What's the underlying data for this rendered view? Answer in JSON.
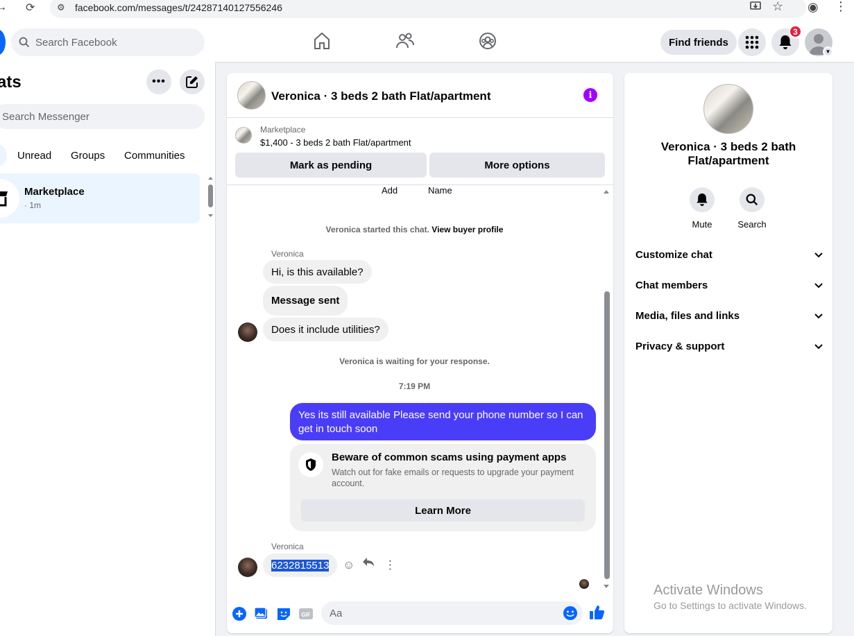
{
  "browser": {
    "url": "facebook.com/messages/t/24287140127556246"
  },
  "header": {
    "search_placeholder": "Search Facebook",
    "find_friends": "Find friends",
    "notifications_count": "3"
  },
  "sidebar": {
    "title": "ats",
    "search_placeholder": "Search Messenger",
    "filters": [
      "Unread",
      "Groups",
      "Communities"
    ],
    "conversation": {
      "name": "Marketplace",
      "time": "· 1m"
    }
  },
  "chat": {
    "title": "Veronica · 3 beds 2 bath Flat/apartment",
    "marketplace_label": "Marketplace",
    "listing": "$1,400 - 3 beds 2 bath Flat/apartment",
    "mark_pending": "Mark as pending",
    "more_options": "More options",
    "cut_add": "Add",
    "cut_name": "Name",
    "started_prefix": "Veronica started this chat.",
    "view_buyer": "View buyer profile",
    "sender_name": "Veronica",
    "msg1": "Hi, is this available?",
    "msg2": "Message sent",
    "msg3": "Does it include utilities?",
    "waiting": "Veronica is waiting for your response.",
    "time": "7:19 PM",
    "outgoing": "Yes its still available Please send your phone number so I can get in touch soon",
    "scam_title": "Beware of common scams using payment apps",
    "scam_desc": "Watch out for fake emails or requests to upgrade your payment account.",
    "learn_more": "Learn More",
    "sender_name2": "Veronica",
    "phone": "6232815513",
    "composer_placeholder": "Aa"
  },
  "info_panel": {
    "name": "Veronica · 3 beds 2 bath Flat/apartment",
    "mute": "Mute",
    "search": "Search",
    "rows": [
      "Customize chat",
      "Chat members",
      "Media, files and links",
      "Privacy & support"
    ]
  },
  "watermark": {
    "line1": "Activate Windows",
    "line2": "Go to Settings to activate Windows."
  },
  "colors": {
    "brand": "#0866ff",
    "outgoing_bubble": "#4a3df7",
    "info_icon": "#a300ff",
    "badge": "#e41e3f"
  }
}
